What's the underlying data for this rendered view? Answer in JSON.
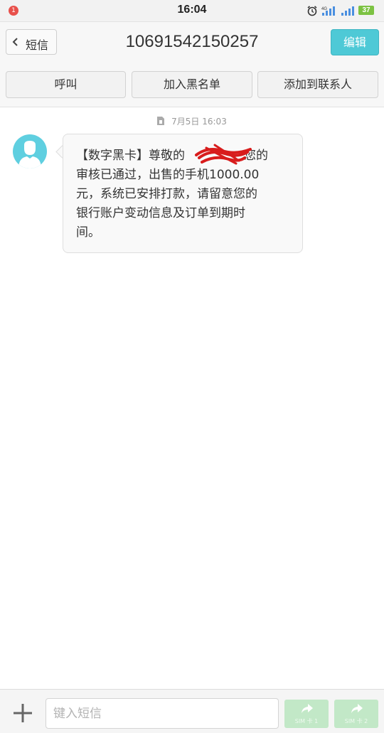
{
  "status_bar": {
    "notification_count": "1",
    "time": "16:04",
    "battery": "37",
    "network": "4G"
  },
  "header": {
    "back_label": "短信",
    "title": "10691542150257",
    "edit_label": "编辑"
  },
  "actions": {
    "call": "呼叫",
    "block": "加入黑名单",
    "add_contact": "添加到联系人"
  },
  "conversation": {
    "timestamp": "7月5日 16:03",
    "message_line1_before": "【数字黑卡】尊敬的",
    "message_line1_after": "，您的",
    "message_line2": "审核已通过，出售的手机1000.00",
    "message_line3": "元，系统已安排打款，请留意您的",
    "message_line4": "银行账户变动信息及订单到期时",
    "message_line5": "间。"
  },
  "composer": {
    "placeholder": "键入短信",
    "send_sim1": "SIM 卡 1",
    "send_sim2": "SIM 卡 2"
  },
  "colors": {
    "accent": "#4ec9d6",
    "avatar": "#5fcfe0",
    "send_disabled": "#c2e8c7",
    "scribble": "#d81c1c"
  }
}
